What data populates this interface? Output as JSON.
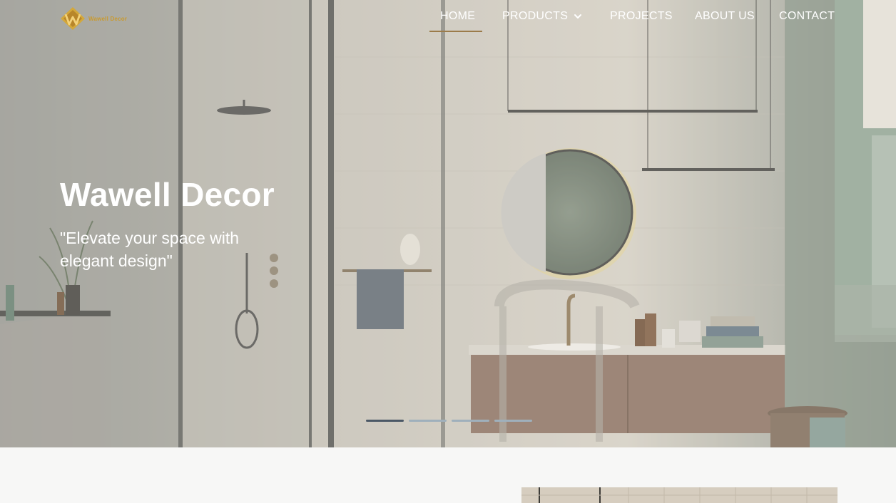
{
  "brand": {
    "name": "Wawell Decor",
    "logo_letter": "W",
    "accent": "#c99a2e"
  },
  "nav": {
    "items": [
      {
        "label": "HOME",
        "active": true
      },
      {
        "label": "PRODUCTS",
        "has_dropdown": true
      },
      {
        "label": "PROJECTS"
      },
      {
        "label": "ABOUT US"
      },
      {
        "label": "CONTACT"
      }
    ],
    "dropdown_icon": "chevron-down-icon"
  },
  "hero": {
    "title": "Wawell Decor",
    "tagline": "\"Elevate your space with elegant design\"",
    "slides_total": 4,
    "active_slide": 1
  },
  "colors": {
    "underline": "#9b7b4a",
    "indicator_active": "#4b5866",
    "indicator_inactive": "#9fb0bc"
  }
}
